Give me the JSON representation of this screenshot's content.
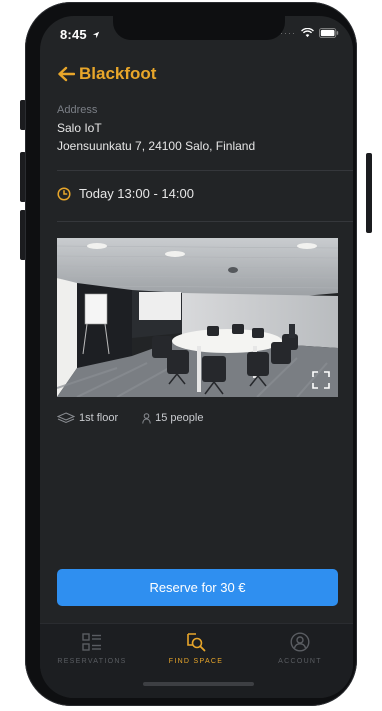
{
  "status": {
    "time": "8:45"
  },
  "header": {
    "title": "Blackfoot"
  },
  "address": {
    "label": "Address",
    "name": "Salo IoT",
    "street": "Joensuunkatu 7, 24100 Salo, Finland"
  },
  "booking": {
    "time": "Today  13:00 - 14:00"
  },
  "details": {
    "floor": "1st floor",
    "capacity": "15 people"
  },
  "actions": {
    "reserve_label": "Reserve for 30 €"
  },
  "tabbar": {
    "tabs": [
      {
        "label": "RESERVATIONS",
        "icon": "list-icon"
      },
      {
        "label": "FIND SPACE",
        "icon": "find-space-icon"
      },
      {
        "label": "ACCOUNT",
        "icon": "account-icon"
      }
    ]
  },
  "colors": {
    "accent": "#e8a62a",
    "primary": "#2f8ff0",
    "background": "#222426"
  }
}
